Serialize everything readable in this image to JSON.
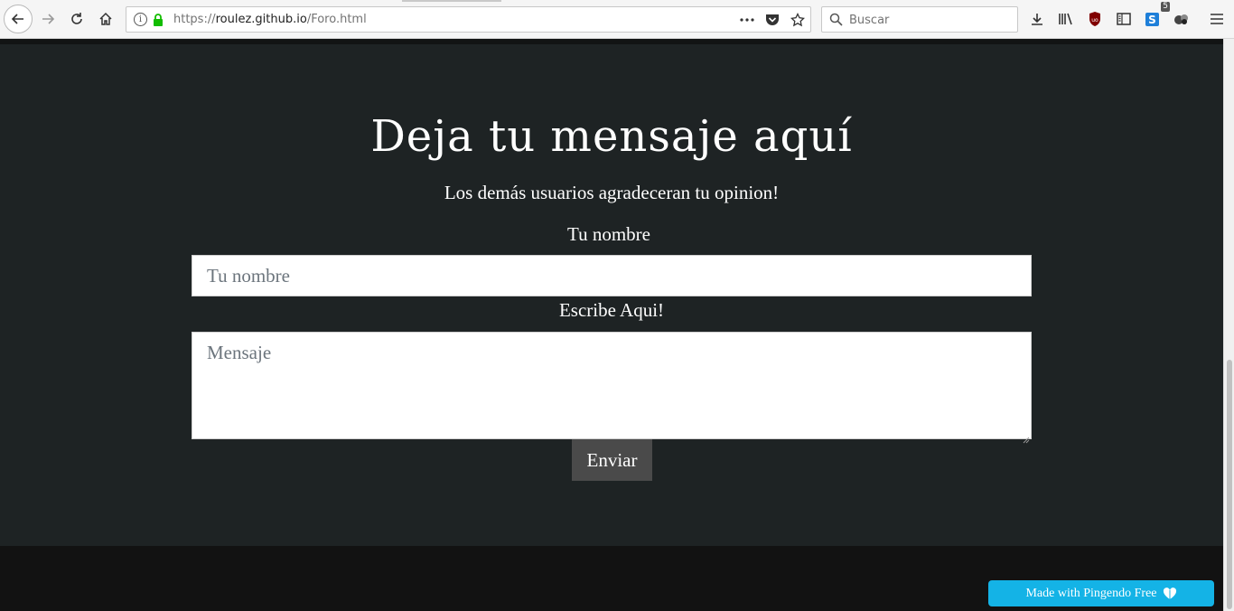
{
  "browser": {
    "url_scheme": "https://",
    "url_host": "roulez.github.io",
    "url_path": "/Foro.html",
    "search_placeholder": "Buscar",
    "extension_badge": "5",
    "info_glyph": "i"
  },
  "page": {
    "heading": "Deja tu mensaje aquí",
    "subheading": "Los demás usuarios agradeceran tu opinion!",
    "name_label": "Tu nombre",
    "name_placeholder": "Tu nombre",
    "message_label": "Escribe Aqui!",
    "message_placeholder": "Mensaje",
    "submit_label": "Enviar"
  },
  "badge_widget": {
    "label": "Made with Pingendo Free"
  },
  "colors": {
    "section_bg": "#1e2324",
    "footer_bg": "#121212",
    "button_bg": "#4a4a4a",
    "pingendo_bg": "#14b3e6"
  }
}
